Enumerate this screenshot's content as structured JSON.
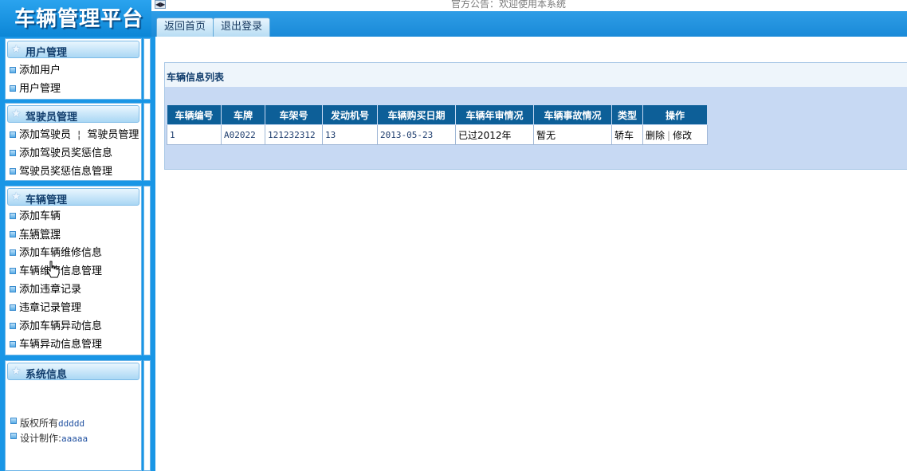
{
  "header": {
    "app_title": "车辆管理平台",
    "announcement": "官方公告：欢迎使用本系统",
    "tabs": [
      {
        "label": "返回首页"
      },
      {
        "label": "退出登录"
      }
    ]
  },
  "sidebar": {
    "sections": [
      {
        "title": "用户管理",
        "items": [
          "添加用户",
          "用户管理"
        ]
      },
      {
        "title": "驾驶员管理",
        "items": [
          "添加驾驶员",
          "驾驶员管理",
          "添加驾驶员奖惩信息",
          "驾驶员奖惩信息管理"
        ],
        "separator": "¦"
      },
      {
        "title": "车辆管理",
        "items": [
          "添加车辆",
          "车辆管理",
          "添加车辆维修信息",
          "车辆维修信息管理",
          "添加违章记录",
          "违章记录管理",
          "添加车辆异动信息",
          "车辆异动信息管理"
        ]
      },
      {
        "title": "系统信息",
        "lines": [
          {
            "label": "版权所有",
            "value": "ddddd"
          },
          {
            "label": "设计制作:",
            "value": "aaaaa"
          }
        ]
      }
    ]
  },
  "main": {
    "list_title": "车辆信息列表",
    "table": {
      "headers": [
        "车辆编号",
        "车牌",
        "车架号",
        "发动机号",
        "车辆购买日期",
        "车辆年审情况",
        "车辆事故情况",
        "类型",
        "操作"
      ],
      "rows": [
        {
          "id": "1",
          "plate": "A02022",
          "frame": "121232312",
          "engine": "13",
          "purchase_date": "2013-05-23",
          "inspection": "已过2012年",
          "accident": "暂无",
          "type": "轿车",
          "actions": [
            "删除",
            "修改"
          ],
          "action_separator": "|"
        }
      ]
    }
  },
  "colors": {
    "sidebar_bg": "#1996e6",
    "table_header_bg": "#0d5f98",
    "accent": "#123e6d"
  },
  "icons": {
    "toggle": "collapse-toggle-icon",
    "section_star": "star-icon",
    "bullet": "square-bullet-icon",
    "cursor": "hand-pointer-icon"
  }
}
